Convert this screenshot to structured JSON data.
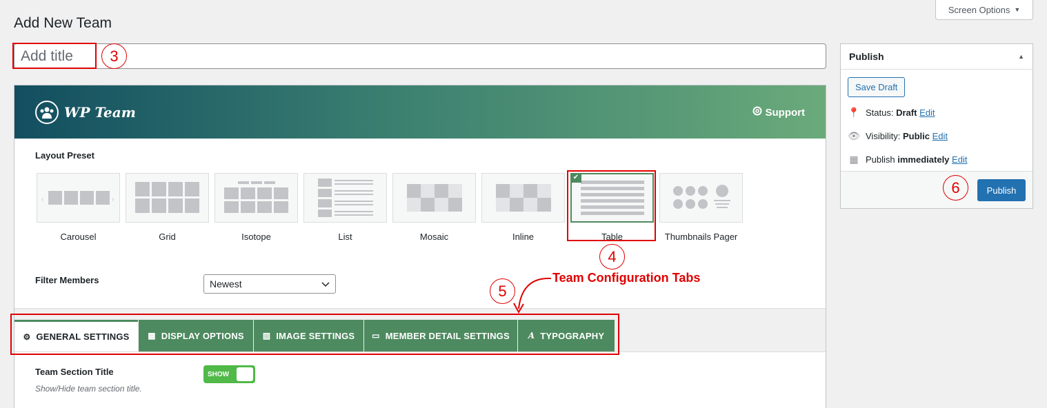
{
  "screen_options": {
    "label": "Screen Options"
  },
  "page": {
    "title": "Add New Team"
  },
  "title_field": {
    "placeholder": "Add title"
  },
  "annotations": {
    "n3": "3",
    "n4": "4",
    "n5": "5",
    "n6": "6",
    "tabs_label": "Team Configuration Tabs"
  },
  "banner": {
    "brand": "WP Team",
    "support": "Support"
  },
  "layout_preset": {
    "label": "Layout Preset",
    "options": [
      "Carousel",
      "Grid",
      "Isotope",
      "List",
      "Mosaic",
      "Inline",
      "Table",
      "Thumbnails Pager"
    ],
    "selected": "Table"
  },
  "filter": {
    "label": "Filter Members",
    "value": "Newest"
  },
  "tabs": [
    "GENERAL SETTINGS",
    "DISPLAY OPTIONS",
    "IMAGE SETTINGS",
    "MEMBER DETAIL SETTINGS",
    "TYPOGRAPHY"
  ],
  "section_title": {
    "label": "Team Section Title",
    "toggle": "SHOW",
    "hint": "Show/Hide team section title."
  },
  "publish": {
    "heading": "Publish",
    "save_draft": "Save Draft",
    "status_label": "Status:",
    "status_value": "Draft",
    "visibility_label": "Visibility:",
    "visibility_value": "Public",
    "publish_label": "Publish",
    "publish_value": "immediately",
    "edit": "Edit",
    "button": "Publish"
  },
  "colors": {
    "accent_green": "#4d8a5f",
    "annotation_red": "#e00000",
    "wp_blue": "#2271b1"
  }
}
